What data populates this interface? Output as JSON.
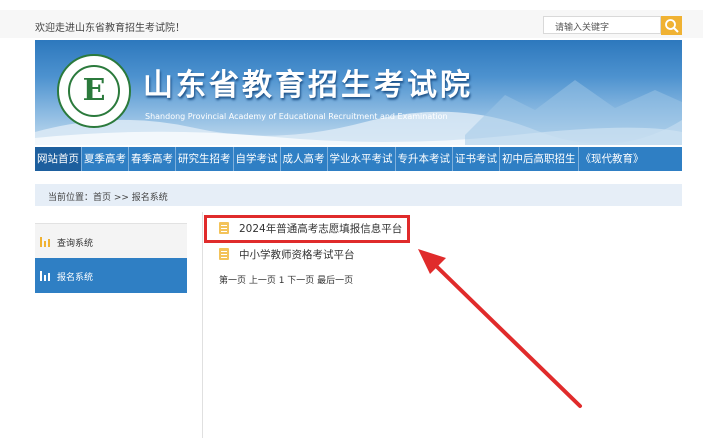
{
  "header": {
    "welcome_text": "欢迎走进山东省教育招生考试院！",
    "search_placeholder": "请输入关键字",
    "search_icon": "search-icon"
  },
  "banner": {
    "title": "山东省教育招生考试院",
    "subtitle": "Shandong Provincial Academy of Educational Recruitment and Examination",
    "logo_letter": "E"
  },
  "nav": {
    "items": [
      {
        "label": "网站首页"
      },
      {
        "label": "夏季高考"
      },
      {
        "label": "春季高考"
      },
      {
        "label": "研究生招考"
      },
      {
        "label": "自学考试"
      },
      {
        "label": "成人高考"
      },
      {
        "label": "学业水平考试"
      },
      {
        "label": "专升本考试"
      },
      {
        "label": "证书考试"
      },
      {
        "label": "初中后高职招生"
      },
      {
        "label": "《现代教育》"
      }
    ]
  },
  "breadcrumb": {
    "text": "当前位置：首页 >> 报名系统"
  },
  "sidebar": {
    "items": [
      {
        "label": "查询系统",
        "icon": "bar-chart-icon"
      },
      {
        "label": "报名系统",
        "icon": "bar-chart-icon"
      }
    ]
  },
  "main": {
    "list": [
      {
        "label": "2024年普通高考志愿填报信息平台",
        "icon": "document-icon"
      },
      {
        "label": "中小学教师资格考试平台",
        "icon": "document-icon"
      }
    ],
    "pager": "第一页 上一页 1 下一页 最后一页"
  },
  "colors": {
    "nav_bg": "#2f7fc4",
    "accent_yellow": "#f0b233",
    "highlight_red": "#e02b2b"
  }
}
